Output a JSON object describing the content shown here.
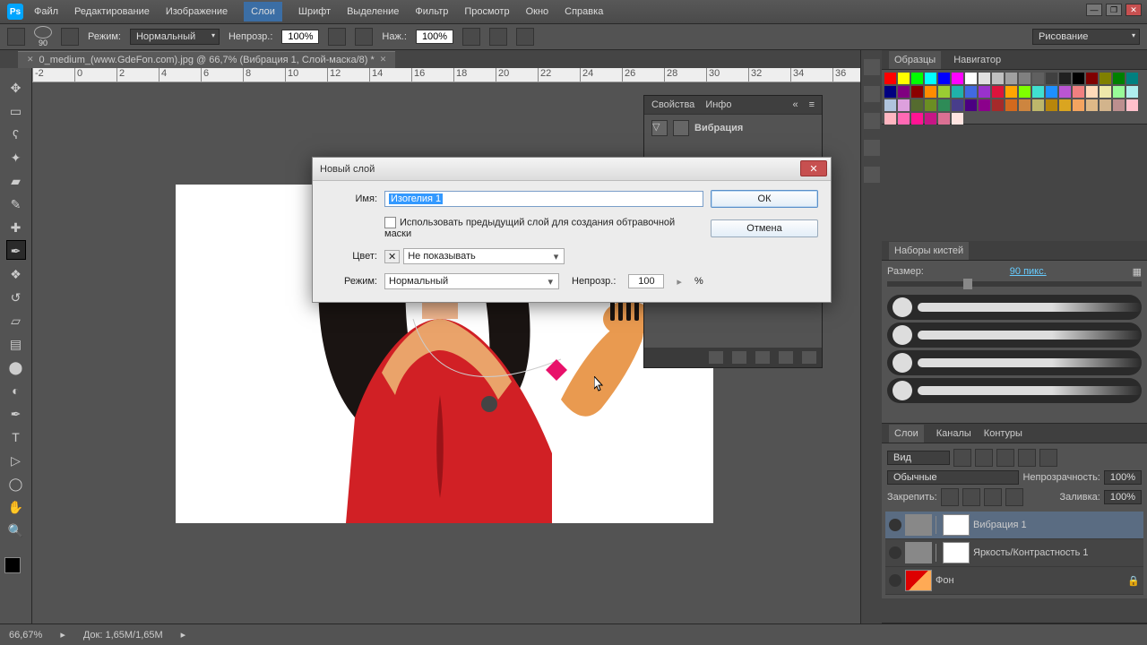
{
  "menu": {
    "items": [
      "Файл",
      "Редактирование",
      "Изображение",
      "Слои",
      "Шрифт",
      "Выделение",
      "Фильтр",
      "Просмотр",
      "Окно",
      "Справка"
    ],
    "selected": 3
  },
  "options": {
    "brush_size": "90",
    "brush_unit": " ",
    "mode_label": "Режим:",
    "mode": "Нормальный",
    "opacity_label": "Непрозр.:",
    "opacity": "100%",
    "flow_label": "Наж.:",
    "flow": "100%",
    "workspace": "Рисование"
  },
  "doc_tab": {
    "name": "0_medium_(www.GdeFon.com).jpg @ 66,7% (Вибрация 1, Слой-маска/8) *"
  },
  "ruler_marks": [
    "-2",
    "0",
    "2",
    "4",
    "6",
    "8",
    "10",
    "12",
    "14",
    "16",
    "18",
    "20",
    "22",
    "24",
    "26",
    "28",
    "30",
    "32",
    "34",
    "36"
  ],
  "status": {
    "zoom": "66,67%",
    "doc": "Док: 1,65M/1,65M"
  },
  "prop_panel": {
    "tab1": "Свойства",
    "tab2": "Инфо",
    "adj_name": "Вибрация"
  },
  "swatch_panel": {
    "tab1": "Образцы",
    "tab2": "Навигатор"
  },
  "brush_panel": {
    "title": "Наборы кистей",
    "size_label": "Размер:",
    "size": "90 пикс."
  },
  "layers_panel": {
    "tabs": [
      "Слои",
      "Каналы",
      "Контуры"
    ],
    "kind": "Вид",
    "blend": "Обычные",
    "opacity_label": "Непрозрачность:",
    "opacity": "100%",
    "lock_label": "Закрепить:",
    "fill_label": "Заливка:",
    "fill": "100%",
    "layers": [
      {
        "name": "Вибрация 1",
        "sel": true,
        "thumb": "adj"
      },
      {
        "name": "Яркость/Контрастность 1",
        "sel": false,
        "thumb": "adj"
      },
      {
        "name": "Фон",
        "sel": false,
        "thumb": "img"
      }
    ]
  },
  "dialog": {
    "title": "Новый слой",
    "name_label": "Имя:",
    "name_value": "Изогелия 1",
    "clip_label": "Использовать предыдущий слой для создания обтравочной маски",
    "color_label": "Цвет:",
    "color_value": "Не показывать",
    "mode_label": "Режим:",
    "mode_value": "Нормальный",
    "opacity_label": "Непрозр.:",
    "opacity_value": "100",
    "opacity_pct": "%",
    "ok": "ОК",
    "cancel": "Отмена"
  },
  "swatch_colors": [
    "#ff0000",
    "#ffff00",
    "#00ff00",
    "#00ffff",
    "#0000ff",
    "#ff00ff",
    "#ffffff",
    "#e0e0e0",
    "#c0c0c0",
    "#a0a0a0",
    "#808080",
    "#606060",
    "#404040",
    "#202020",
    "#000000",
    "#800000",
    "#808000",
    "#008000",
    "#008080",
    "#000080",
    "#800080",
    "#8b0000",
    "#ff8c00",
    "#9acd32",
    "#20b2aa",
    "#4169e1",
    "#9932cc",
    "#dc143c",
    "#ffa500",
    "#7fff00",
    "#40e0d0",
    "#1e90ff",
    "#ba55d3",
    "#f08080",
    "#ffdab9",
    "#eee8aa",
    "#98fb98",
    "#afeeee",
    "#b0c4de",
    "#dda0dd",
    "#556b2f",
    "#6b8e23",
    "#2e8b57",
    "#483d8b",
    "#4b0082",
    "#8b008b",
    "#a52a2a",
    "#d2691e",
    "#cd853f",
    "#bdb76b",
    "#b8860b",
    "#daa520",
    "#f4a460",
    "#deb887",
    "#d2b48c",
    "#bc8f8f",
    "#ffc0cb",
    "#ffb6c1",
    "#ff69b4",
    "#ff1493",
    "#c71585",
    "#db7093",
    "#ffe4e1"
  ]
}
